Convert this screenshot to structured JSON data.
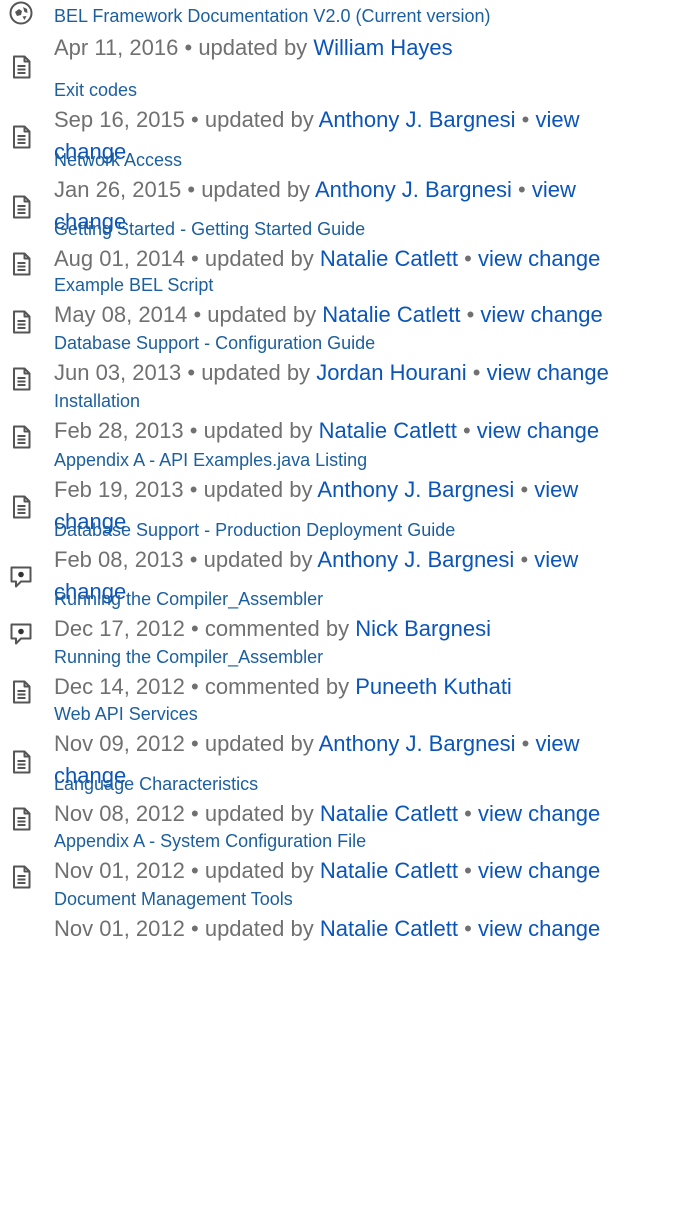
{
  "activity": [
    {
      "icon": "space-icon",
      "title": "BEL Framework Documentation V2.0 (Current version)",
      "date": "Apr 11, 2016",
      "separator": "•",
      "action": "updated by",
      "author": "William Hayes"
    },
    {
      "icon": "page-icon",
      "title": "Exit codes",
      "date": "Sep 16, 2015",
      "separator": "•",
      "action": "updated by",
      "author": "Anthony J. Bargnesi",
      "change": "view change"
    },
    {
      "icon": "page-icon",
      "title": "Network Access",
      "date": "Jan 26, 2015",
      "separator": "•",
      "action": "updated by",
      "author": "Anthony J. Bargnesi",
      "change": "view change"
    },
    {
      "icon": "page-icon",
      "title": "Getting Started - Getting Started Guide",
      "date": "Aug 01, 2014",
      "separator": "•",
      "action": "updated by",
      "author": "Natalie Catlett",
      "change": "view change"
    },
    {
      "icon": "page-icon",
      "title": "Example BEL Script",
      "date": "May 08, 2014",
      "separator": "•",
      "action": "updated by",
      "author": "Natalie Catlett",
      "change": "view change"
    },
    {
      "icon": "page-icon",
      "title": "Database Support - Configuration Guide",
      "date": "Jun 03, 2013",
      "separator": "•",
      "action": "updated by",
      "author": "Jordan Hourani",
      "change": "view change"
    },
    {
      "icon": "page-icon",
      "title": "Installation",
      "date": "Feb 28, 2013",
      "separator": "•",
      "action": "updated by",
      "author": "Natalie Catlett",
      "change": "view change"
    },
    {
      "icon": "page-icon",
      "title": "Appendix A - API Examples.java Listing",
      "date": "Feb 19, 2013",
      "separator": "•",
      "action": "updated by",
      "author": "Anthony J. Bargnesi",
      "change": "view change"
    },
    {
      "icon": "page-icon",
      "title": "Database Support - Production Deployment Guide",
      "date": "Feb 08, 2013",
      "separator": "•",
      "action": "updated by",
      "author": "Anthony J. Bargnesi",
      "change": "view change"
    },
    {
      "icon": "comment-icon",
      "title": "Running the Compiler_Assembler",
      "date": "Dec 17, 2012",
      "separator": "•",
      "action": "commented by",
      "author": "Nick Bargnesi"
    },
    {
      "icon": "comment-icon",
      "title": "Running the Compiler_Assembler",
      "date": "Dec 14, 2012",
      "separator": "•",
      "action": "commented by",
      "author": "Puneeth Kuthati"
    },
    {
      "icon": "page-icon",
      "title": "Web API Services",
      "date": "Nov 09, 2012",
      "separator": "•",
      "action": "updated by",
      "author": "Anthony J. Bargnesi",
      "change": "view change"
    },
    {
      "icon": "page-icon",
      "title": "Language Characteristics",
      "date": "Nov 08, 2012",
      "separator": "•",
      "action": "updated by",
      "author": "Natalie Catlett",
      "change": "view change"
    },
    {
      "icon": "page-icon",
      "title": "Appendix A - System Configuration File",
      "date": "Nov 01, 2012",
      "separator": "•",
      "action": "updated by",
      "author": "Natalie Catlett",
      "change": "view change"
    },
    {
      "icon": "page-icon",
      "title": "Document Management Tools",
      "date": "Nov 01, 2012",
      "separator": "•",
      "action": "updated by",
      "author": "Natalie Catlett",
      "change": "view change"
    }
  ]
}
